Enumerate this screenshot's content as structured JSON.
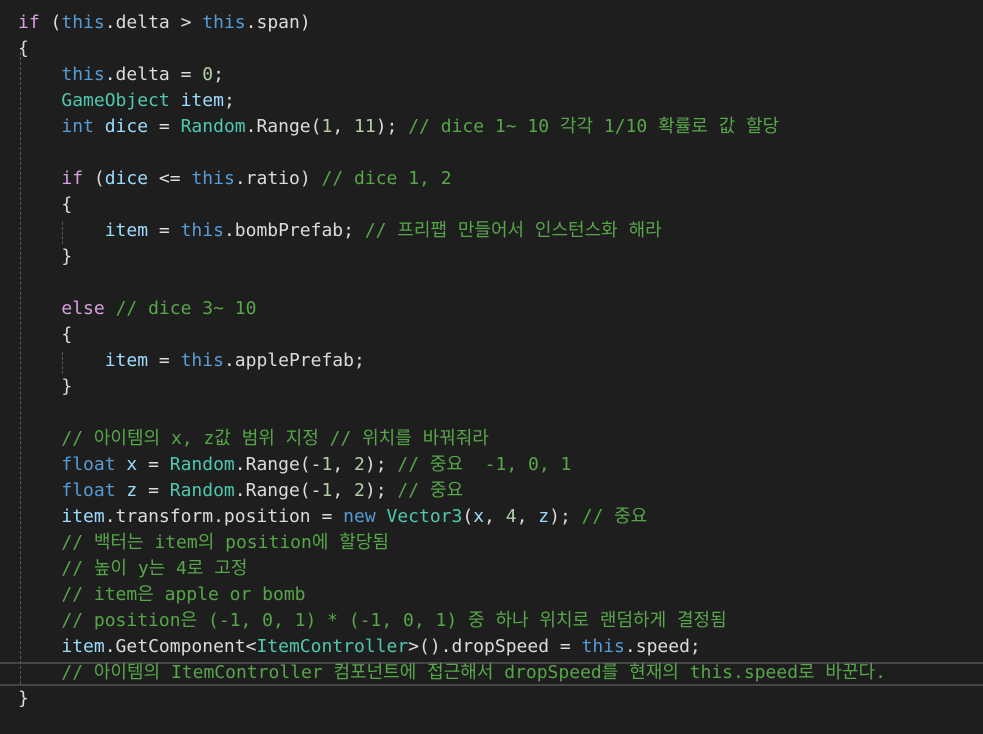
{
  "colors": {
    "background": "#1e1e1e",
    "keyword": "#569cd6",
    "control": "#d8a0df",
    "type": "#4ec9b0",
    "identifier": "#9cdcfe",
    "number": "#b5cea8",
    "comment": "#57a64a",
    "plain": "#dcdcdc"
  },
  "lines": [
    [
      [
        "ctl",
        "if"
      ],
      [
        "pl",
        " ("
      ],
      [
        "kw",
        "this"
      ],
      [
        "pl",
        ".delta > "
      ],
      [
        "kw",
        "this"
      ],
      [
        "pl",
        ".span)"
      ]
    ],
    [
      [
        "pl",
        "{"
      ]
    ],
    [
      [
        "pl",
        "    "
      ],
      [
        "kw",
        "this"
      ],
      [
        "pl",
        ".delta = "
      ],
      [
        "num",
        "0"
      ],
      [
        "pl",
        ";"
      ]
    ],
    [
      [
        "pl",
        "    "
      ],
      [
        "cls",
        "GameObject"
      ],
      [
        "pl",
        " "
      ],
      [
        "id",
        "item"
      ],
      [
        "pl",
        ";"
      ]
    ],
    [
      [
        "pl",
        "    "
      ],
      [
        "kw",
        "int"
      ],
      [
        "pl",
        " "
      ],
      [
        "id",
        "dice"
      ],
      [
        "pl",
        " = "
      ],
      [
        "cls",
        "Random"
      ],
      [
        "pl",
        ".Range("
      ],
      [
        "num",
        "1"
      ],
      [
        "pl",
        ", "
      ],
      [
        "num",
        "11"
      ],
      [
        "pl",
        "); "
      ],
      [
        "cm",
        "// dice 1~ 10 각각 1/10 확률로 값 할당"
      ]
    ],
    [
      [
        "pl",
        ""
      ]
    ],
    [
      [
        "pl",
        "    "
      ],
      [
        "ctl",
        "if"
      ],
      [
        "pl",
        " ("
      ],
      [
        "id",
        "dice"
      ],
      [
        "pl",
        " <= "
      ],
      [
        "kw",
        "this"
      ],
      [
        "pl",
        ".ratio) "
      ],
      [
        "cm",
        "// dice 1, 2"
      ]
    ],
    [
      [
        "pl",
        "    {"
      ]
    ],
    [
      [
        "pl",
        "        "
      ],
      [
        "id",
        "item"
      ],
      [
        "pl",
        " = "
      ],
      [
        "kw",
        "this"
      ],
      [
        "pl",
        ".bombPrefab; "
      ],
      [
        "cm",
        "// 프리팹 만들어서 인스턴스화 해라"
      ]
    ],
    [
      [
        "pl",
        "    }"
      ]
    ],
    [
      [
        "pl",
        ""
      ]
    ],
    [
      [
        "pl",
        "    "
      ],
      [
        "ctl",
        "else"
      ],
      [
        "pl",
        " "
      ],
      [
        "cm",
        "// dice 3~ 10"
      ]
    ],
    [
      [
        "pl",
        "    {"
      ]
    ],
    [
      [
        "pl",
        "        "
      ],
      [
        "id",
        "item"
      ],
      [
        "pl",
        " = "
      ],
      [
        "kw",
        "this"
      ],
      [
        "pl",
        ".applePrefab;"
      ]
    ],
    [
      [
        "pl",
        "    }"
      ]
    ],
    [
      [
        "pl",
        ""
      ]
    ],
    [
      [
        "pl",
        "    "
      ],
      [
        "cm",
        "// 아이템의 x, z값 범위 지정 // 위치를 바꿔줘라"
      ]
    ],
    [
      [
        "pl",
        "    "
      ],
      [
        "kw",
        "float"
      ],
      [
        "pl",
        " "
      ],
      [
        "id",
        "x"
      ],
      [
        "pl",
        " = "
      ],
      [
        "cls",
        "Random"
      ],
      [
        "pl",
        ".Range(-"
      ],
      [
        "num",
        "1"
      ],
      [
        "pl",
        ", "
      ],
      [
        "num",
        "2"
      ],
      [
        "pl",
        "); "
      ],
      [
        "cm",
        "// 중요  -1, 0, 1"
      ]
    ],
    [
      [
        "pl",
        "    "
      ],
      [
        "kw",
        "float"
      ],
      [
        "pl",
        " "
      ],
      [
        "id",
        "z"
      ],
      [
        "pl",
        " = "
      ],
      [
        "cls",
        "Random"
      ],
      [
        "pl",
        ".Range(-"
      ],
      [
        "num",
        "1"
      ],
      [
        "pl",
        ", "
      ],
      [
        "num",
        "2"
      ],
      [
        "pl",
        "); "
      ],
      [
        "cm",
        "// 중요"
      ]
    ],
    [
      [
        "pl",
        "    "
      ],
      [
        "id",
        "item"
      ],
      [
        "pl",
        ".transform.position = "
      ],
      [
        "kw",
        "new"
      ],
      [
        "pl",
        " "
      ],
      [
        "cls",
        "Vector3"
      ],
      [
        "pl",
        "("
      ],
      [
        "id",
        "x"
      ],
      [
        "pl",
        ", "
      ],
      [
        "num",
        "4"
      ],
      [
        "pl",
        ", "
      ],
      [
        "id",
        "z"
      ],
      [
        "pl",
        "); "
      ],
      [
        "cm",
        "// 중요"
      ]
    ],
    [
      [
        "pl",
        "    "
      ],
      [
        "cm",
        "// 백터는 item의 position에 할당됨"
      ]
    ],
    [
      [
        "pl",
        "    "
      ],
      [
        "cm",
        "// 높이 y는 4로 고정"
      ]
    ],
    [
      [
        "pl",
        "    "
      ],
      [
        "cm",
        "// item은 apple or bomb"
      ]
    ],
    [
      [
        "pl",
        "    "
      ],
      [
        "cm",
        "// position은 (-1, 0, 1) * (-1, 0, 1) 중 하나 위치로 랜덤하게 결정됨"
      ]
    ],
    [
      [
        "pl",
        "    "
      ],
      [
        "id",
        "item"
      ],
      [
        "pl",
        ".GetComponent<"
      ],
      [
        "cls",
        "ItemController"
      ],
      [
        "pl",
        ">().dropSpeed = "
      ],
      [
        "kw",
        "this"
      ],
      [
        "pl",
        ".speed;"
      ]
    ],
    [
      [
        "pl",
        "    "
      ],
      [
        "cm",
        "// 아이템의 ItemController 컴포넌트에 접근해서 dropSpeed를 현재의 this.speed로 바꾼다."
      ]
    ],
    [
      [
        "pl",
        "}"
      ]
    ]
  ]
}
